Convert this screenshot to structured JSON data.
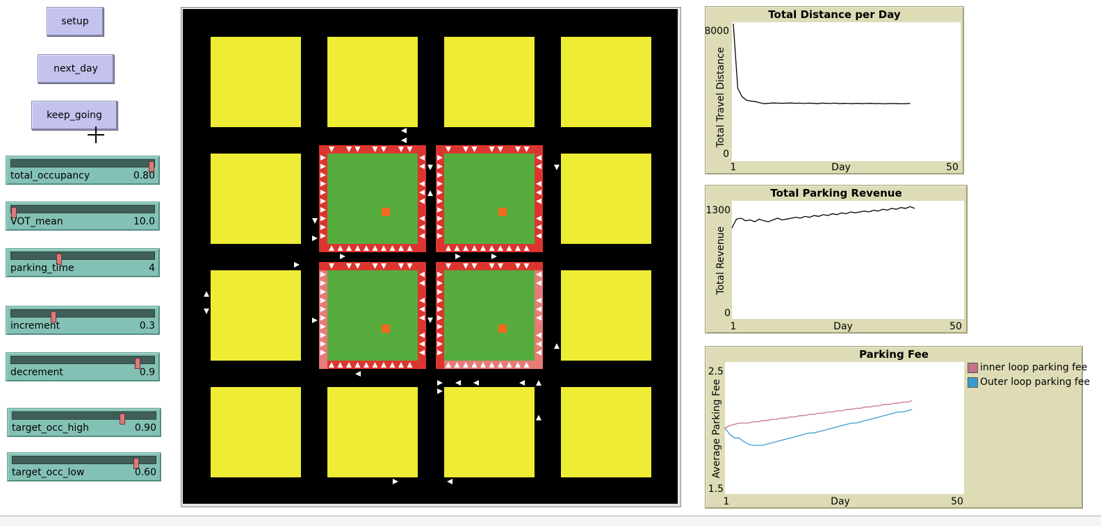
{
  "buttons": {
    "setup": "setup",
    "next_day": "next_day",
    "keep_going": "keep_going"
  },
  "sliders": [
    {
      "id": "total_occupancy",
      "label": "total_occupancy",
      "value": "0.80",
      "level": 1.0
    },
    {
      "id": "vot_mean",
      "label": "VOT_mean",
      "value": "10.0",
      "level": 0.0
    },
    {
      "id": "parking_time",
      "label": "parking_time",
      "value": "4",
      "level": 0.33
    },
    {
      "id": "increment",
      "label": "increment",
      "value": "0.3",
      "level": 0.29
    },
    {
      "id": "decrement",
      "label": "decrement",
      "value": "0.9",
      "level": 0.9
    },
    {
      "id": "target_occ_high",
      "label": "target_occ_high",
      "value": "0.90",
      "level": 0.78
    },
    {
      "id": "target_occ_low",
      "label": "target_occ_low",
      "value": "0.60",
      "level": 0.88
    }
  ],
  "colors": {
    "block": "#eeec34",
    "road": "#000000",
    "lot": "#55ac3c",
    "spot_red": "#dc352f",
    "spot_pink": "#e77b79",
    "spot_dark": "#5c1a1a",
    "center": "#ef6a1c"
  },
  "plots": {
    "distance": {
      "title": "Total Distance per Day",
      "ylabel": "Total Travel Distance",
      "xlabel": "Day",
      "x_min": "1",
      "x_max": "50",
      "y_min": "0",
      "y_max": "8000"
    },
    "revenue": {
      "title": "Total Parking Revenue",
      "ylabel": "Total Revenue",
      "xlabel": "Day",
      "x_min": "1",
      "x_max": "50",
      "y_min": "0",
      "y_max": "1300"
    },
    "fee": {
      "title": "Parking Fee",
      "ylabel": "Average Parking  Fee",
      "xlabel": "Day",
      "x_min": "1",
      "x_max": "50",
      "y_min": "1.5",
      "y_max": "2.5",
      "legend": [
        {
          "name": "inner loop parking fee",
          "color": "#c5728a"
        },
        {
          "name": "Outer loop parking fee",
          "color": "#3a9bd4"
        }
      ]
    }
  },
  "chart_data": [
    {
      "type": "line",
      "title": "Total Distance per Day",
      "xlabel": "Day",
      "ylabel": "Total Travel Distance",
      "xlim": [
        1,
        50
      ],
      "ylim": [
        0,
        8000
      ],
      "series": [
        {
          "x": [
            1,
            2,
            3,
            4,
            5,
            6,
            7,
            8,
            9,
            10,
            11,
            12,
            13,
            14,
            15,
            16,
            17,
            18,
            19,
            20,
            21,
            22,
            23,
            24,
            25,
            26,
            27,
            28,
            29,
            30,
            31,
            32,
            33,
            34,
            35,
            36,
            37,
            38,
            39,
            40,
            41
          ],
          "y": [
            8600,
            4200,
            3700,
            3500,
            3450,
            3420,
            3350,
            3300,
            3320,
            3340,
            3330,
            3320,
            3330,
            3340,
            3320,
            3330,
            3310,
            3330,
            3320,
            3300,
            3330,
            3320,
            3310,
            3330,
            3300,
            3320,
            3310,
            3300,
            3320,
            3300,
            3310,
            3320,
            3300,
            3310,
            3290,
            3300,
            3310,
            3300,
            3290,
            3300,
            3310
          ],
          "color": "#000000"
        }
      ]
    },
    {
      "type": "line",
      "title": "Total Parking Revenue",
      "xlabel": "Day",
      "ylabel": "Total Revenue",
      "xlim": [
        1,
        50
      ],
      "ylim": [
        0,
        1300
      ],
      "series": [
        {
          "x": [
            1,
            2,
            3,
            4,
            5,
            6,
            7,
            8,
            9,
            10,
            11,
            12,
            13,
            14,
            15,
            16,
            17,
            18,
            19,
            20,
            21,
            22,
            23,
            24,
            25,
            26,
            27,
            28,
            29,
            30,
            31,
            32,
            33,
            34,
            35,
            36,
            37,
            38,
            39,
            40,
            41
          ],
          "y": [
            1010,
            1110,
            1120,
            1090,
            1100,
            1080,
            1110,
            1090,
            1080,
            1100,
            1120,
            1100,
            1110,
            1120,
            1130,
            1120,
            1140,
            1130,
            1150,
            1140,
            1160,
            1150,
            1170,
            1160,
            1180,
            1170,
            1190,
            1180,
            1190,
            1200,
            1190,
            1210,
            1200,
            1220,
            1210,
            1230,
            1220,
            1240,
            1230,
            1250,
            1230
          ],
          "color": "#000000"
        }
      ]
    },
    {
      "type": "line",
      "title": "Parking Fee",
      "xlabel": "Day",
      "ylabel": "Average Parking  Fee",
      "xlim": [
        1,
        50
      ],
      "ylim": [
        1.5,
        2.5
      ],
      "series": [
        {
          "name": "inner loop parking fee",
          "color": "#c5728a",
          "x": [
            1,
            2,
            3,
            4,
            5,
            6,
            7,
            8,
            9,
            10,
            11,
            12,
            13,
            14,
            15,
            16,
            17,
            18,
            19,
            20,
            21,
            22,
            23,
            24,
            25,
            26,
            27,
            28,
            29,
            30,
            31,
            32,
            33,
            34,
            35,
            36,
            37,
            38,
            39,
            40,
            41
          ],
          "y": [
            2.0,
            2.02,
            2.03,
            2.04,
            2.04,
            2.04,
            2.05,
            2.05,
            2.06,
            2.06,
            2.07,
            2.07,
            2.08,
            2.08,
            2.09,
            2.09,
            2.1,
            2.1,
            2.11,
            2.11,
            2.12,
            2.12,
            2.13,
            2.13,
            2.14,
            2.14,
            2.15,
            2.15,
            2.16,
            2.16,
            2.17,
            2.17,
            2.18,
            2.18,
            2.19,
            2.19,
            2.2,
            2.2,
            2.21,
            2.21,
            2.22
          ]
        },
        {
          "name": "Outer loop parking fee",
          "color": "#3a9bd4",
          "x": [
            1,
            2,
            3,
            4,
            5,
            6,
            7,
            8,
            9,
            10,
            11,
            12,
            13,
            14,
            15,
            16,
            17,
            18,
            19,
            20,
            21,
            22,
            23,
            24,
            25,
            26,
            27,
            28,
            29,
            30,
            31,
            32,
            33,
            34,
            35,
            36,
            37,
            38,
            39,
            40,
            41
          ],
          "y": [
            2.0,
            1.95,
            1.92,
            1.92,
            1.89,
            1.87,
            1.86,
            1.86,
            1.86,
            1.87,
            1.88,
            1.89,
            1.9,
            1.91,
            1.92,
            1.93,
            1.94,
            1.95,
            1.96,
            1.96,
            1.97,
            1.98,
            1.99,
            2.0,
            2.01,
            2.02,
            2.03,
            2.04,
            2.04,
            2.05,
            2.06,
            2.07,
            2.08,
            2.09,
            2.1,
            2.11,
            2.12,
            2.13,
            2.13,
            2.14,
            2.15
          ]
        }
      ]
    }
  ]
}
